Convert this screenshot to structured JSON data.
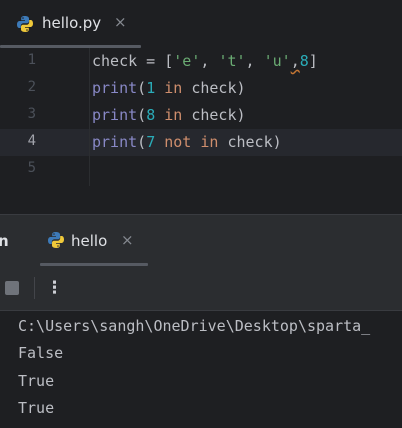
{
  "editor": {
    "tab": {
      "label": "hello.py",
      "close": "×"
    },
    "lines": [
      {
        "num": "1"
      },
      {
        "num": "2"
      },
      {
        "num": "3"
      },
      {
        "num": "4"
      },
      {
        "num": "5"
      }
    ],
    "code": {
      "l1": {
        "name": "check",
        "eq": " = [",
        "s1": "'e'",
        "c1": ", ",
        "s2": "'t'",
        "c2": ", ",
        "s3": "'u'",
        "c3": ",",
        "n1": "8",
        "end": "]"
      },
      "l2": {
        "fn": "print",
        "open": "(",
        "num": "1",
        "kw": " in ",
        "var": "check",
        "close": ")"
      },
      "l3": {
        "fn": "print",
        "open": "(",
        "num": "8",
        "kw": " in ",
        "var": "check",
        "close": ")"
      },
      "l4": {
        "fn": "print",
        "open": "(",
        "num": "7",
        "kw1": " not",
        "kw2": " in ",
        "var": "check",
        "close": ")"
      }
    }
  },
  "run_panel": {
    "label": "n",
    "tab": {
      "label": "hello",
      "close": "×"
    },
    "more": "⋮"
  },
  "console": {
    "lines": [
      "C:\\Users\\sangh\\OneDrive\\Desktop\\sparta_",
      "False",
      "True",
      "True"
    ]
  },
  "colors": {
    "background": "#1e1f22",
    "panel": "#2b2d30",
    "string": "#6aab73",
    "number": "#2aacb8",
    "keyword": "#cf8e6d",
    "builtin": "#8888c6"
  },
  "icons": {
    "file": "python-icon",
    "close": "close-icon",
    "stop": "stop-icon",
    "more": "more-vertical-icon"
  }
}
